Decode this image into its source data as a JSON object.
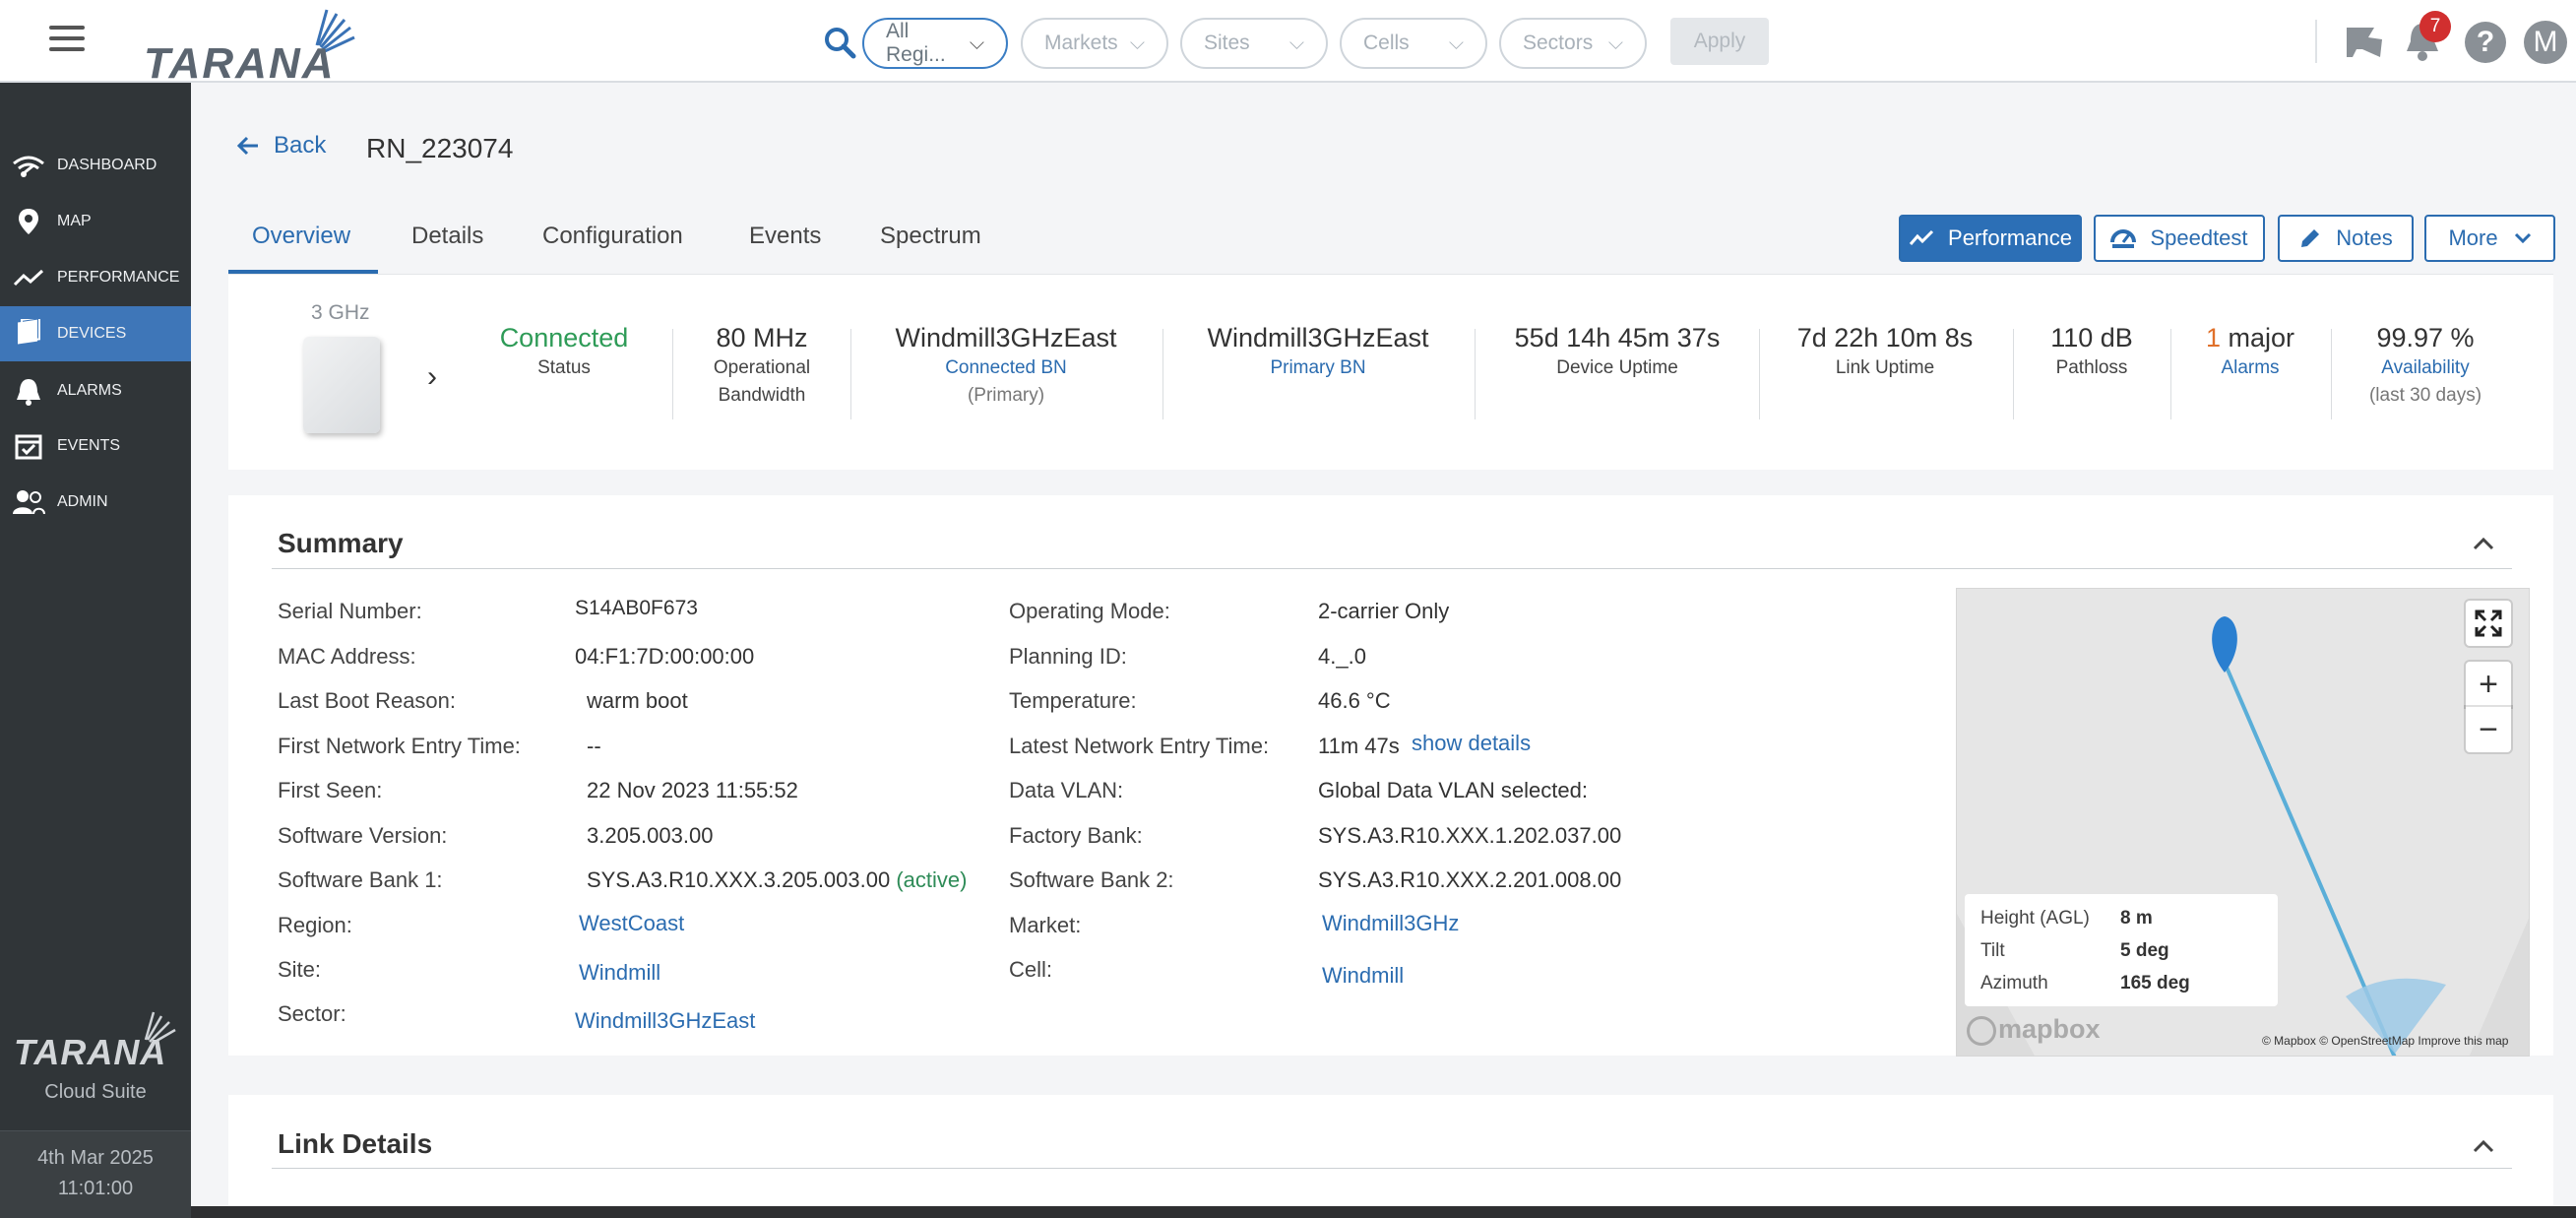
{
  "header": {
    "brand": "TARANA",
    "filters": {
      "regions": "All Regi...",
      "markets": "Markets",
      "sites": "Sites",
      "cells": "Cells",
      "sectors": "Sectors"
    },
    "apply_label": "Apply",
    "notification_count": "7",
    "help_label": "?",
    "avatar_initial": "M"
  },
  "sidebar": {
    "items": [
      {
        "label": "DASHBOARD",
        "icon": "wifi-signal-icon"
      },
      {
        "label": "MAP",
        "icon": "map-pin-icon"
      },
      {
        "label": "PERFORMANCE",
        "icon": "trend-line-icon"
      },
      {
        "label": "DEVICES",
        "icon": "device-stack-icon",
        "active": true
      },
      {
        "label": "ALARMS",
        "icon": "alarm-bell-icon"
      },
      {
        "label": "EVENTS",
        "icon": "calendar-check-icon"
      },
      {
        "label": "ADMIN",
        "icon": "users-icon"
      }
    ],
    "brand": "TARANA",
    "suite": "Cloud Suite",
    "date": "4th Mar 2025",
    "time": "11:01:00"
  },
  "page": {
    "back_label": "Back",
    "title": "RN_223074",
    "tabs": [
      "Overview",
      "Details",
      "Configuration",
      "Events",
      "Spectrum"
    ],
    "actions": {
      "performance": "Performance",
      "speedtest": "Speedtest",
      "notes": "Notes",
      "more": "More"
    }
  },
  "status": {
    "frequency": "3 GHz",
    "connection_value": "Connected",
    "connection_label": "Status",
    "bandwidth_value": "80 MHz",
    "bandwidth_label1": "Operational",
    "bandwidth_label2": "Bandwidth",
    "connected_bn_value": "Windmill3GHzEast",
    "connected_bn_label": "Connected BN",
    "connected_bn_sub": "(Primary)",
    "primary_bn_value": "Windmill3GHzEast",
    "primary_bn_label": "Primary BN",
    "device_uptime_value": "55d 14h 45m 37s",
    "device_uptime_label": "Device Uptime",
    "link_uptime_value": "7d 22h 10m 8s",
    "link_uptime_label": "Link Uptime",
    "pathloss_value": "110 dB",
    "pathloss_label": "Pathloss",
    "alarms_count": "1",
    "alarms_severity": " major",
    "alarms_label": "Alarms",
    "availability_value": "99.97 %",
    "availability_label": "Availability",
    "availability_sub": "(last 30 days)",
    "colors": {
      "connected": "#2e9b57",
      "major": "#e0702a",
      "link": "#2b6cb0"
    }
  },
  "summary": {
    "title": "Summary",
    "left": [
      {
        "label": "Serial Number:",
        "value": "S14AB0F673"
      },
      {
        "label": "MAC Address:",
        "value": "04:F1:7D:00:00:00"
      },
      {
        "label": "Last Boot Reason:",
        "value": "warm boot"
      },
      {
        "label": "First Network Entry Time:",
        "value": "--"
      },
      {
        "label": "First Seen:",
        "value": "22 Nov 2023 11:55:52"
      },
      {
        "label": "Software Version:",
        "value": "3.205.003.00"
      },
      {
        "label": "Software Bank 1:",
        "value": "SYS.A3.R10.XXX.3.205.003.00",
        "tag": "(active)"
      },
      {
        "label": "Region:",
        "value": "WestCoast"
      },
      {
        "label": "Site:",
        "value": "Windmill"
      },
      {
        "label": "Sector:",
        "value": "Windmill3GHzEast"
      }
    ],
    "right": [
      {
        "label": "Operating Mode:",
        "value": "2-carrier Only"
      },
      {
        "label": "Planning ID:",
        "value": "4._.0"
      },
      {
        "label": "Temperature:",
        "value": "46.6 °C"
      },
      {
        "label": "Latest Network Entry Time:",
        "value": "11m 47s",
        "link": "show details"
      },
      {
        "label": "Data VLAN:",
        "value": "Global Data VLAN selected:"
      },
      {
        "label": "Factory Bank:",
        "value": "SYS.A3.R10.XXX.1.202.037.00"
      },
      {
        "label": "Software Bank 2:",
        "value": "SYS.A3.R10.XXX.2.201.008.00"
      },
      {
        "label": "Market:",
        "value": "Windmill3GHz"
      },
      {
        "label": "Cell:",
        "value": "Windmill"
      }
    ]
  },
  "map": {
    "info": [
      {
        "label": "Height (AGL)",
        "value": "8 m"
      },
      {
        "label": "Tilt",
        "value": "5 deg"
      },
      {
        "label": "Azimuth",
        "value": "165 deg"
      }
    ],
    "logo": "mapbox",
    "attribution": "© Mapbox © OpenStreetMap Improve this map",
    "zoom_in": "+",
    "zoom_out": "−"
  },
  "link_details": {
    "title": "Link Details"
  }
}
